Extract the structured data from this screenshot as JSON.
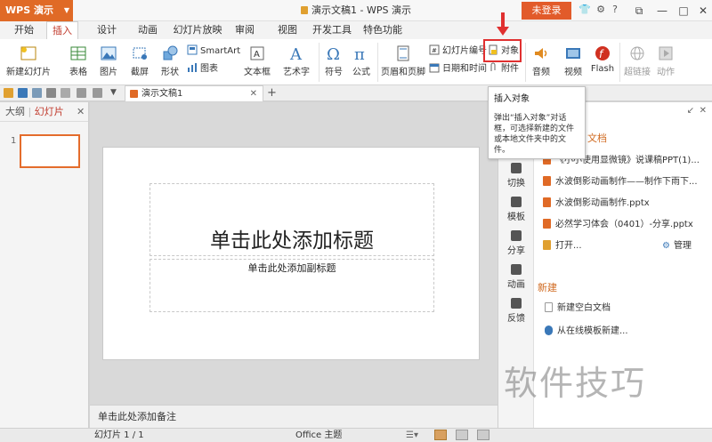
{
  "titlebar": {
    "app_menu": "WPS 演示",
    "doc_title": "演示文稿1 - WPS 演示",
    "login": "未登录"
  },
  "tabs": [
    "开始",
    "插入",
    "设计",
    "动画",
    "幻灯片放映",
    "审阅",
    "视图",
    "开发工具",
    "特色功能"
  ],
  "ribbon": {
    "new_slide": "新建幻灯片",
    "table": "表格",
    "picture": "图片",
    "screenshot": "截屏",
    "shape": "形状",
    "smartart": "SmartArt",
    "chart": "图表",
    "textbox": "文本框",
    "wordart": "艺术字",
    "symbol": "符号",
    "formula": "公式",
    "header_footer": "页眉和页脚",
    "slide_number": "幻灯片编号",
    "date_time": "日期和时间",
    "object": "对象",
    "attachment": "附件",
    "audio": "音频",
    "video": "视频",
    "flash": "Flash",
    "hyperlink": "超链接",
    "action": "动作"
  },
  "doc_tab": {
    "name": "演示文稿1"
  },
  "left_pane": {
    "outline": "大纲",
    "slides": "幻灯片",
    "slide_number": "1"
  },
  "slide": {
    "title_placeholder": "单击此处添加标题",
    "subtitle_placeholder": "单击此处添加副标题"
  },
  "notes": "单击此处添加备注",
  "tooltip": {
    "title": "插入对象",
    "body": "弹出“插入对象”对话框，可选择新建的文件或本地文件夹中的文件。"
  },
  "right_pane": {
    "side_items": [
      "切换",
      "模板",
      "分享",
      "动画",
      "反馈"
    ],
    "open_docs_title": "文档",
    "docs": [
      "《小小使用显微镜》说课稿PPT(1)...",
      "水波倒影动画制作——制作下雨下...",
      "水波倒影动画制作.pptx",
      "必然学习体会（0401）-分享.pptx"
    ],
    "open": "打开...",
    "manage": "管理",
    "new_section": "新建",
    "new_blank": "新建空白文档",
    "new_online": "从在线模板新建..."
  },
  "statusbar": {
    "slide_counter": "幻灯片 1 / 1",
    "theme": "Office 主题"
  },
  "watermark": "软件技巧",
  "colors": {
    "accent": "#e06a26",
    "highlight": "#e03030"
  }
}
